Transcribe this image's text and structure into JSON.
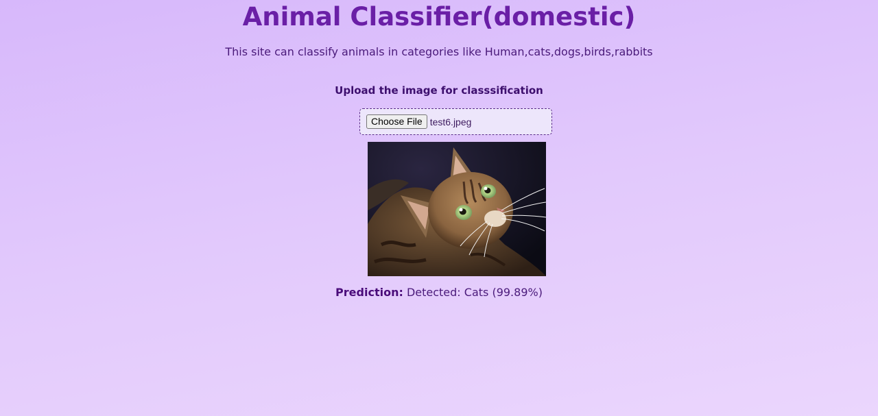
{
  "header": {
    "title": "Animal Classifier(domestic)",
    "subtitle": "This site can classify animals in categories like Human,cats,dogs,birds,rabbits"
  },
  "upload": {
    "label": "Upload the image for classsification",
    "button_label": "Choose File",
    "file_name": "test6.jpeg"
  },
  "preview": {
    "icon": "cat-photo"
  },
  "result": {
    "label": "Prediction:",
    "value": "Detected: Cats (99.89%)"
  },
  "colors": {
    "title": "#6a1fa6",
    "background_start": "#d7b8fb",
    "background_end": "#ebd6fd",
    "border": "#5a2a8a"
  }
}
